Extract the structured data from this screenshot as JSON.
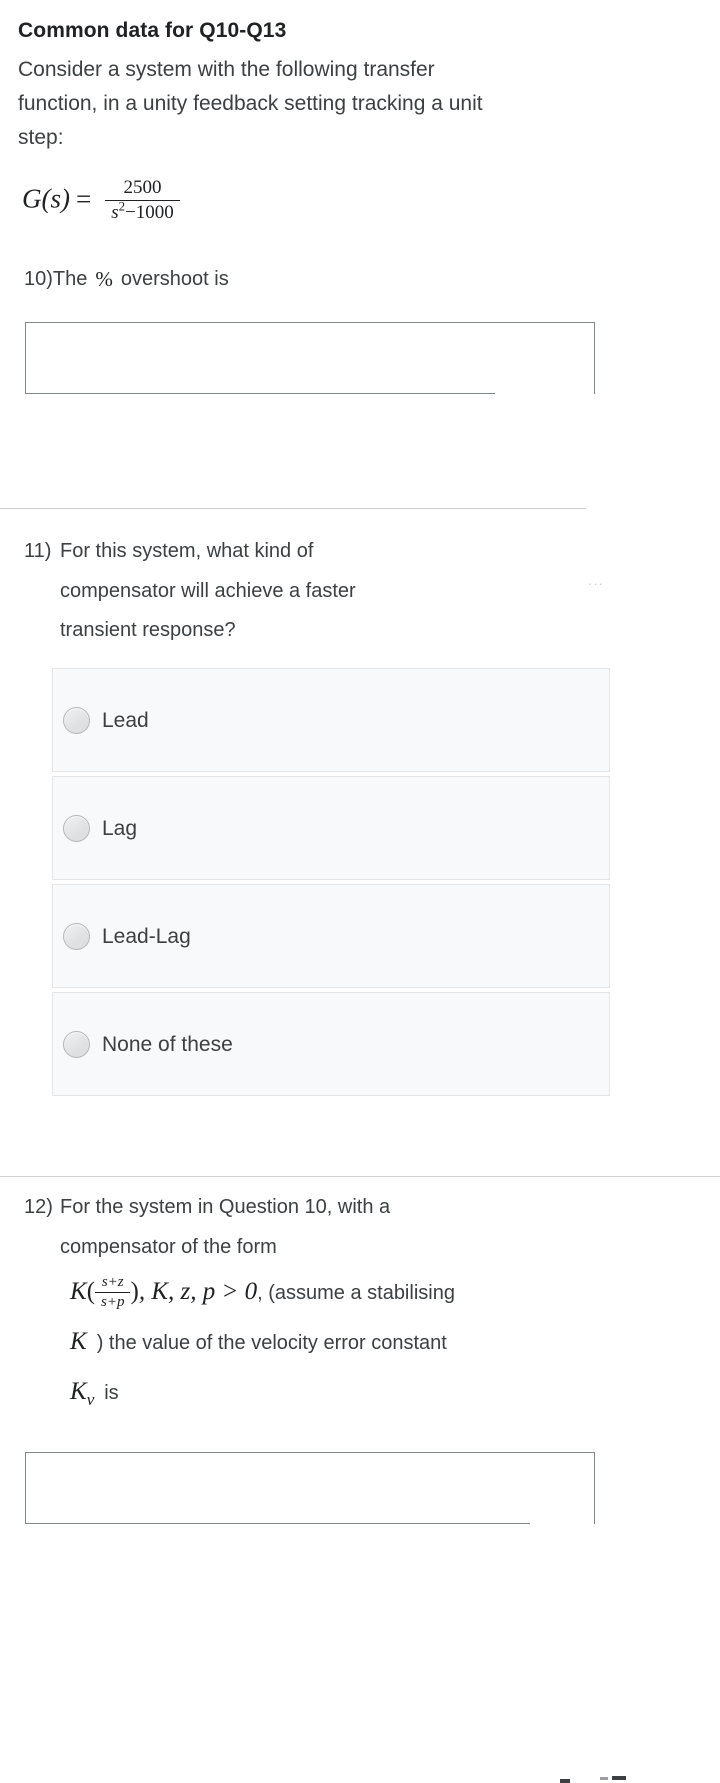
{
  "common": {
    "title": "Common data for Q10-Q13",
    "text_line1": "Consider a system with the following transfer",
    "text_line2": "function, in a unity feedback setting tracking a unit",
    "text_line3": "step:",
    "formula": {
      "lhs": "G(s)",
      "equals": "=",
      "numerator": "2500",
      "denominator_base": "s",
      "denominator_exponent": "2",
      "denominator_rest": "−1000",
      "plain": "G(s) = 2500 / (s^2 - 1000)"
    }
  },
  "questions": [
    {
      "number": "10)",
      "type": "text-entry",
      "text_before": "The",
      "symbol": "%",
      "text_after": "overshoot is",
      "plain": "10) The % overshoot is",
      "answer_value": "",
      "answer_placeholder": ""
    },
    {
      "number": "11)",
      "type": "multiple-choice",
      "line1": "For this system, what kind of",
      "line2": "compensator will achieve a faster",
      "line3": "transient response?",
      "plain": "11) For this system, what kind of compensator will achieve a faster transient response?",
      "options": [
        {
          "label": "Lead",
          "selected": false
        },
        {
          "label": "Lag",
          "selected": false
        },
        {
          "label": "Lead-Lag",
          "selected": false
        },
        {
          "label": "None of these",
          "selected": false
        }
      ],
      "side_marker": "···"
    },
    {
      "number": "12)",
      "type": "text-entry",
      "line1": "For the system in Question 10, with a",
      "line2": "compensator of the form",
      "math": {
        "k": "K",
        "open_paren": "(",
        "frac_num": "s+z",
        "frac_den": "s+p",
        "close_paren": ")",
        "conditions": ", K, z, p > 0",
        "tail": ", (assume a stabilising"
      },
      "line4_math": "K",
      "line4_tail": ") the value of the velocity error constant",
      "line5_math_base": "K",
      "line5_math_sub": "v",
      "line5_tail": "is",
      "plain": "12) For the system in Question 10, with a compensator of the form K((s+z)/(s+p)), K, z, p > 0 , (assume a stabilising K ) the value of the velocity error constant Kv is",
      "answer_value": "",
      "answer_placeholder": ""
    }
  ],
  "colors": {
    "page_background": "#ffffff",
    "text": "#3c4043",
    "heading": "#202124",
    "option_background": "#f8f9fa",
    "option_border": "#e4e6e8",
    "radio_border": "#b3b6ba",
    "divider": "#dadce0",
    "input_border": "#80868b"
  }
}
